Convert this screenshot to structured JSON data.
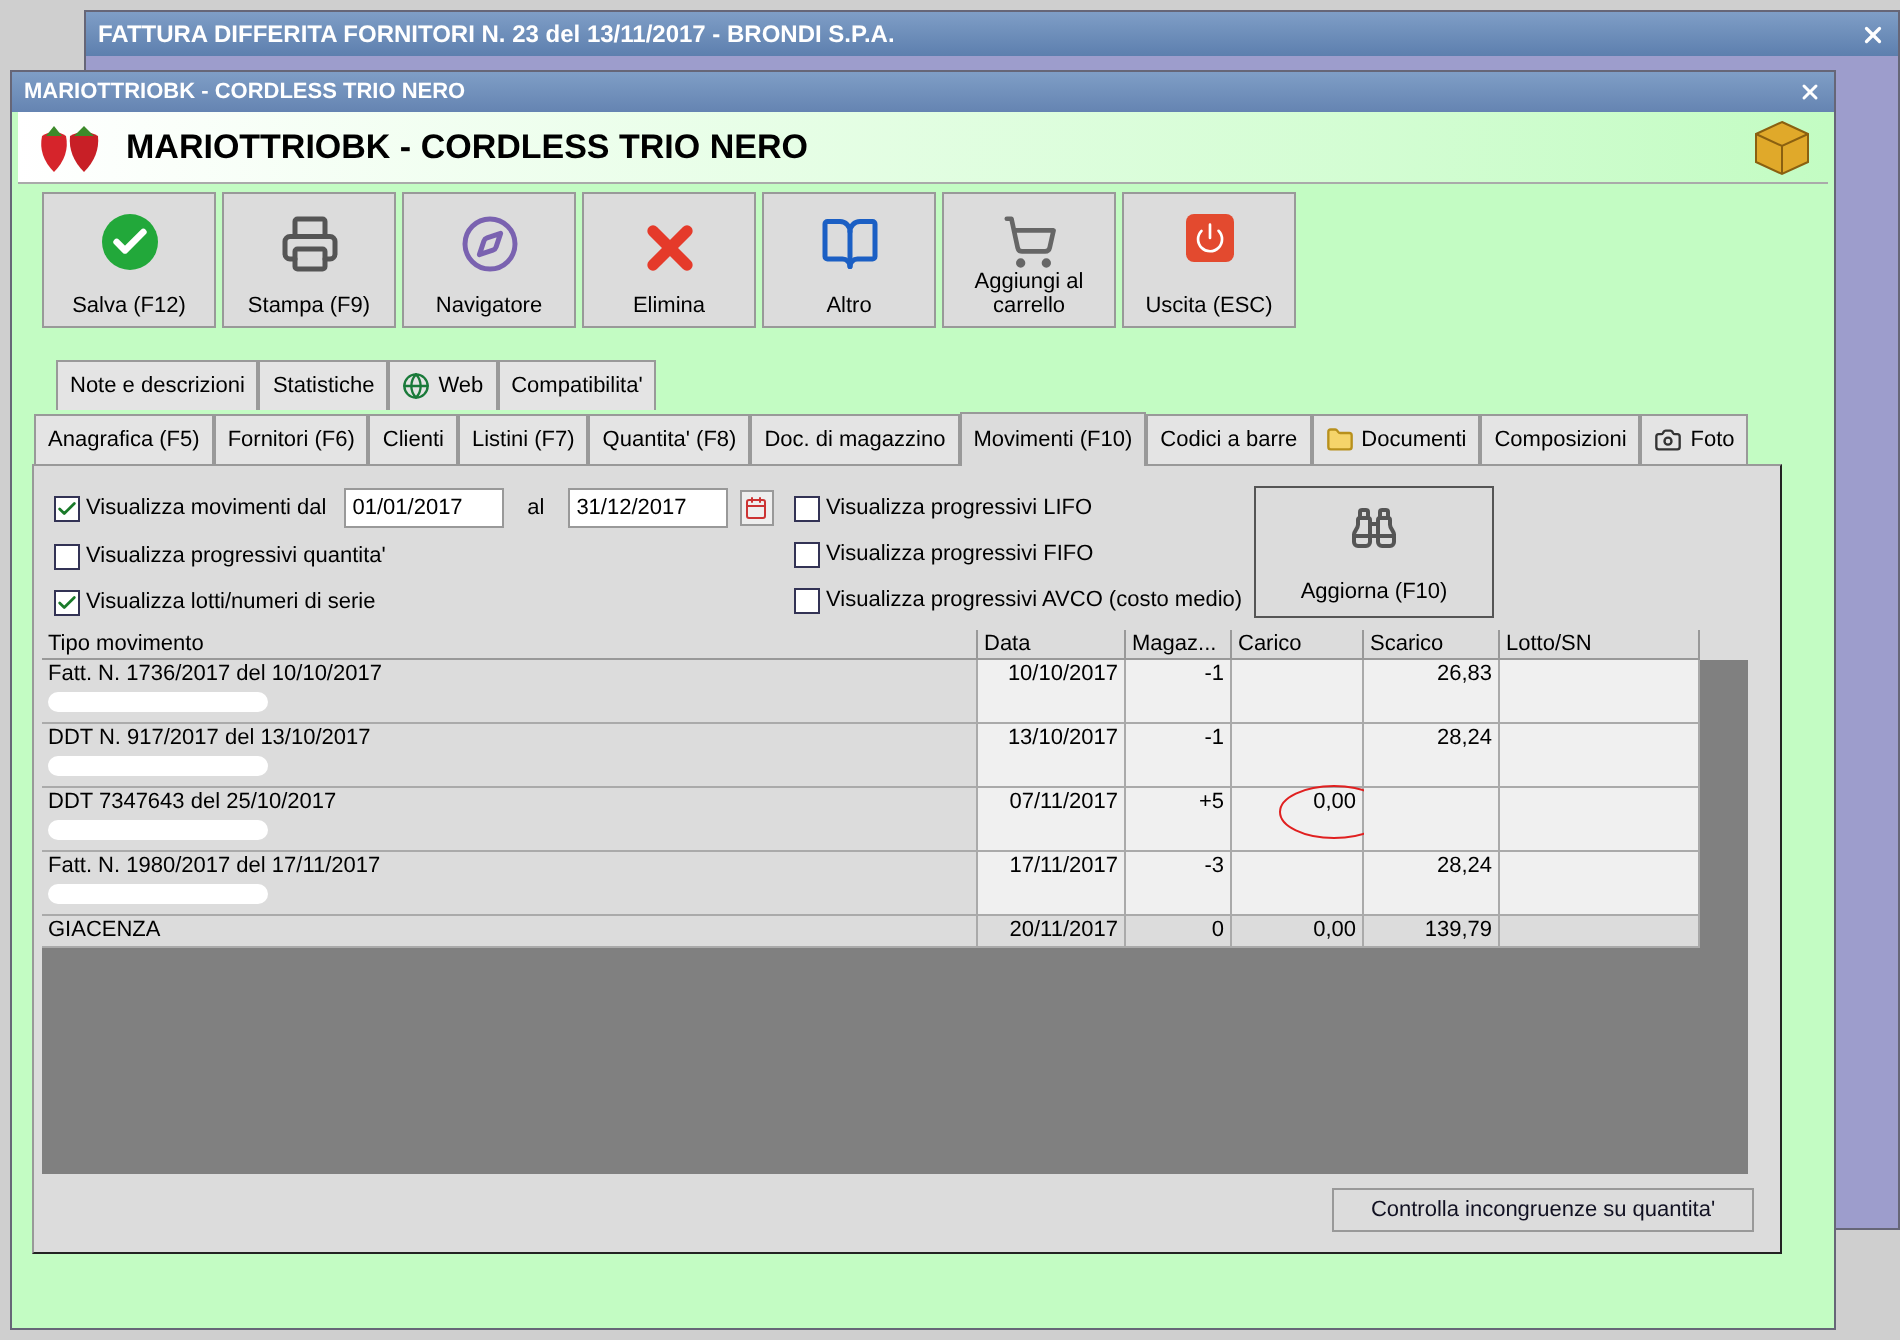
{
  "background_window": {
    "title": "FATTURA DIFFERITA FORNITORI N. 23 del 13/11/2017 - BRONDI S.P.A."
  },
  "window": {
    "title": "MARIOTTRIOBK - CORDLESS TRIO NERO",
    "heading": "MARIOTTRIOBK - CORDLESS TRIO NERO"
  },
  "toolbar": [
    {
      "label": "Salva (F12)",
      "kind": "save"
    },
    {
      "label": "Stampa (F9)",
      "kind": "print"
    },
    {
      "label": "Navigatore",
      "kind": "compass"
    },
    {
      "label": "Elimina",
      "kind": "delete"
    },
    {
      "label": "Altro",
      "kind": "more"
    },
    {
      "label": "Aggiungi al carrello",
      "kind": "cart"
    },
    {
      "label": "Uscita (ESC)",
      "kind": "exit"
    }
  ],
  "tabs_upper": [
    {
      "label": "Note e descrizioni",
      "selected": false,
      "kind": "text"
    },
    {
      "label": "Statistiche",
      "selected": false,
      "kind": "text"
    },
    {
      "label": "Web",
      "selected": false,
      "kind": "globe"
    },
    {
      "label": "Compatibilita'",
      "selected": false,
      "kind": "text"
    }
  ],
  "tabs_lower": [
    {
      "label": "Anagrafica (F5)",
      "selected": false,
      "kind": "text"
    },
    {
      "label": "Fornitori (F6)",
      "selected": false,
      "kind": "text"
    },
    {
      "label": "Clienti",
      "selected": false,
      "kind": "text"
    },
    {
      "label": "Listini (F7)",
      "selected": false,
      "kind": "text"
    },
    {
      "label": "Quantita' (F8)",
      "selected": false,
      "kind": "text"
    },
    {
      "label": "Doc. di magazzino",
      "selected": false,
      "kind": "text"
    },
    {
      "label": "Movimenti (F10)",
      "selected": true,
      "kind": "text"
    },
    {
      "label": "Codici a barre",
      "selected": false,
      "kind": "text"
    },
    {
      "label": "Documenti",
      "selected": false,
      "kind": "folder"
    },
    {
      "label": "Composizioni",
      "selected": false,
      "kind": "text"
    },
    {
      "label": "Foto",
      "selected": false,
      "kind": "camera"
    }
  ],
  "filters": {
    "date_range": {
      "label": "Visualizza movimenti dal",
      "checked": true,
      "from": "01/01/2017",
      "to_label": "al",
      "to": "31/12/2017"
    },
    "left_options": [
      {
        "label": "Visualizza progressivi quantita'",
        "checked": false
      },
      {
        "label": "Visualizza lotti/numeri di serie",
        "checked": true
      }
    ],
    "right_options": [
      {
        "label": "Visualizza progressivi LIFO",
        "checked": false
      },
      {
        "label": "Visualizza progressivi FIFO",
        "checked": false
      },
      {
        "label": "Visualizza progressivi AVCO (costo medio)",
        "checked": false
      }
    ],
    "refresh_button": "Aggiorna (F10)"
  },
  "table": {
    "columns": [
      "Tipo movimento",
      "Data",
      "Magaz...",
      "Carico",
      "Scarico",
      "Lotto/SN"
    ],
    "rows": [
      {
        "kind": "movement",
        "cells": [
          "Fatt. N. 1736/2017 del 10/10/2017",
          "10/10/2017",
          "-1",
          "",
          "26,83",
          ""
        ],
        "redacted": true,
        "circled": false
      },
      {
        "kind": "movement",
        "cells": [
          "DDT N. 917/2017 del 13/10/2017",
          "13/10/2017",
          "-1",
          "",
          "28,24",
          ""
        ],
        "redacted": true,
        "circled": false
      },
      {
        "kind": "movement",
        "cells": [
          "DDT 7347643 del 25/10/2017",
          "07/11/2017",
          "+5",
          "0,00",
          "",
          ""
        ],
        "redacted": true,
        "circled": true
      },
      {
        "kind": "movement",
        "cells": [
          "Fatt. N. 1980/2017 del 17/11/2017",
          "17/11/2017",
          "-3",
          "",
          "28,24",
          ""
        ],
        "redacted": true,
        "circled": false
      },
      {
        "kind": "total",
        "cells": [
          "GIACENZA",
          "20/11/2017",
          "0",
          "0,00",
          "139,79",
          ""
        ],
        "redacted": false,
        "circled": false
      }
    ]
  },
  "check_button": "Controlla incongruenze su quantita'"
}
